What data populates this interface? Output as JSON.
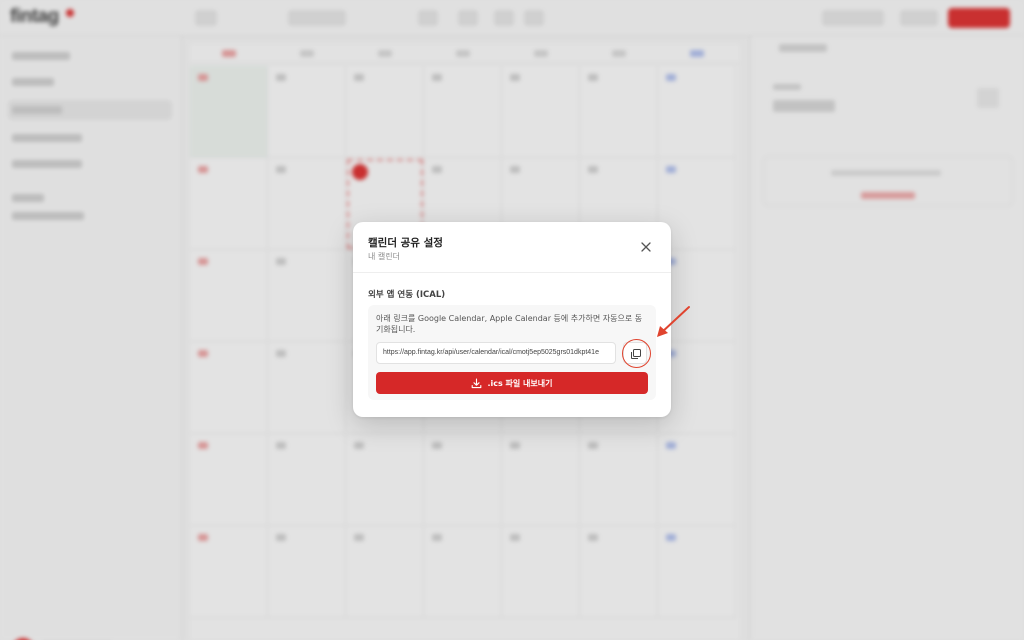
{
  "app": {
    "logo_text": "fintag"
  },
  "modal": {
    "title": "캘린더 공유 설정",
    "subtitle": "내 캘린더",
    "close_icon": "close-icon",
    "section_label": "외부 앱 연동 (ICAL)",
    "description": "아래 링크를 Google Calendar, Apple Calendar 등에 추가하면 자동으로 동기화됩니다.",
    "ical_url": "https://app.fintag.kr/api/user/calendar/ical/cmotj5ep5025grs01dkpt41e",
    "copy_icon": "copy-icon",
    "export_icon": "download-icon",
    "export_label": ".ics 파일 내보내기"
  },
  "colors": {
    "accent": "#d62828",
    "annotation": "#e0442f"
  }
}
